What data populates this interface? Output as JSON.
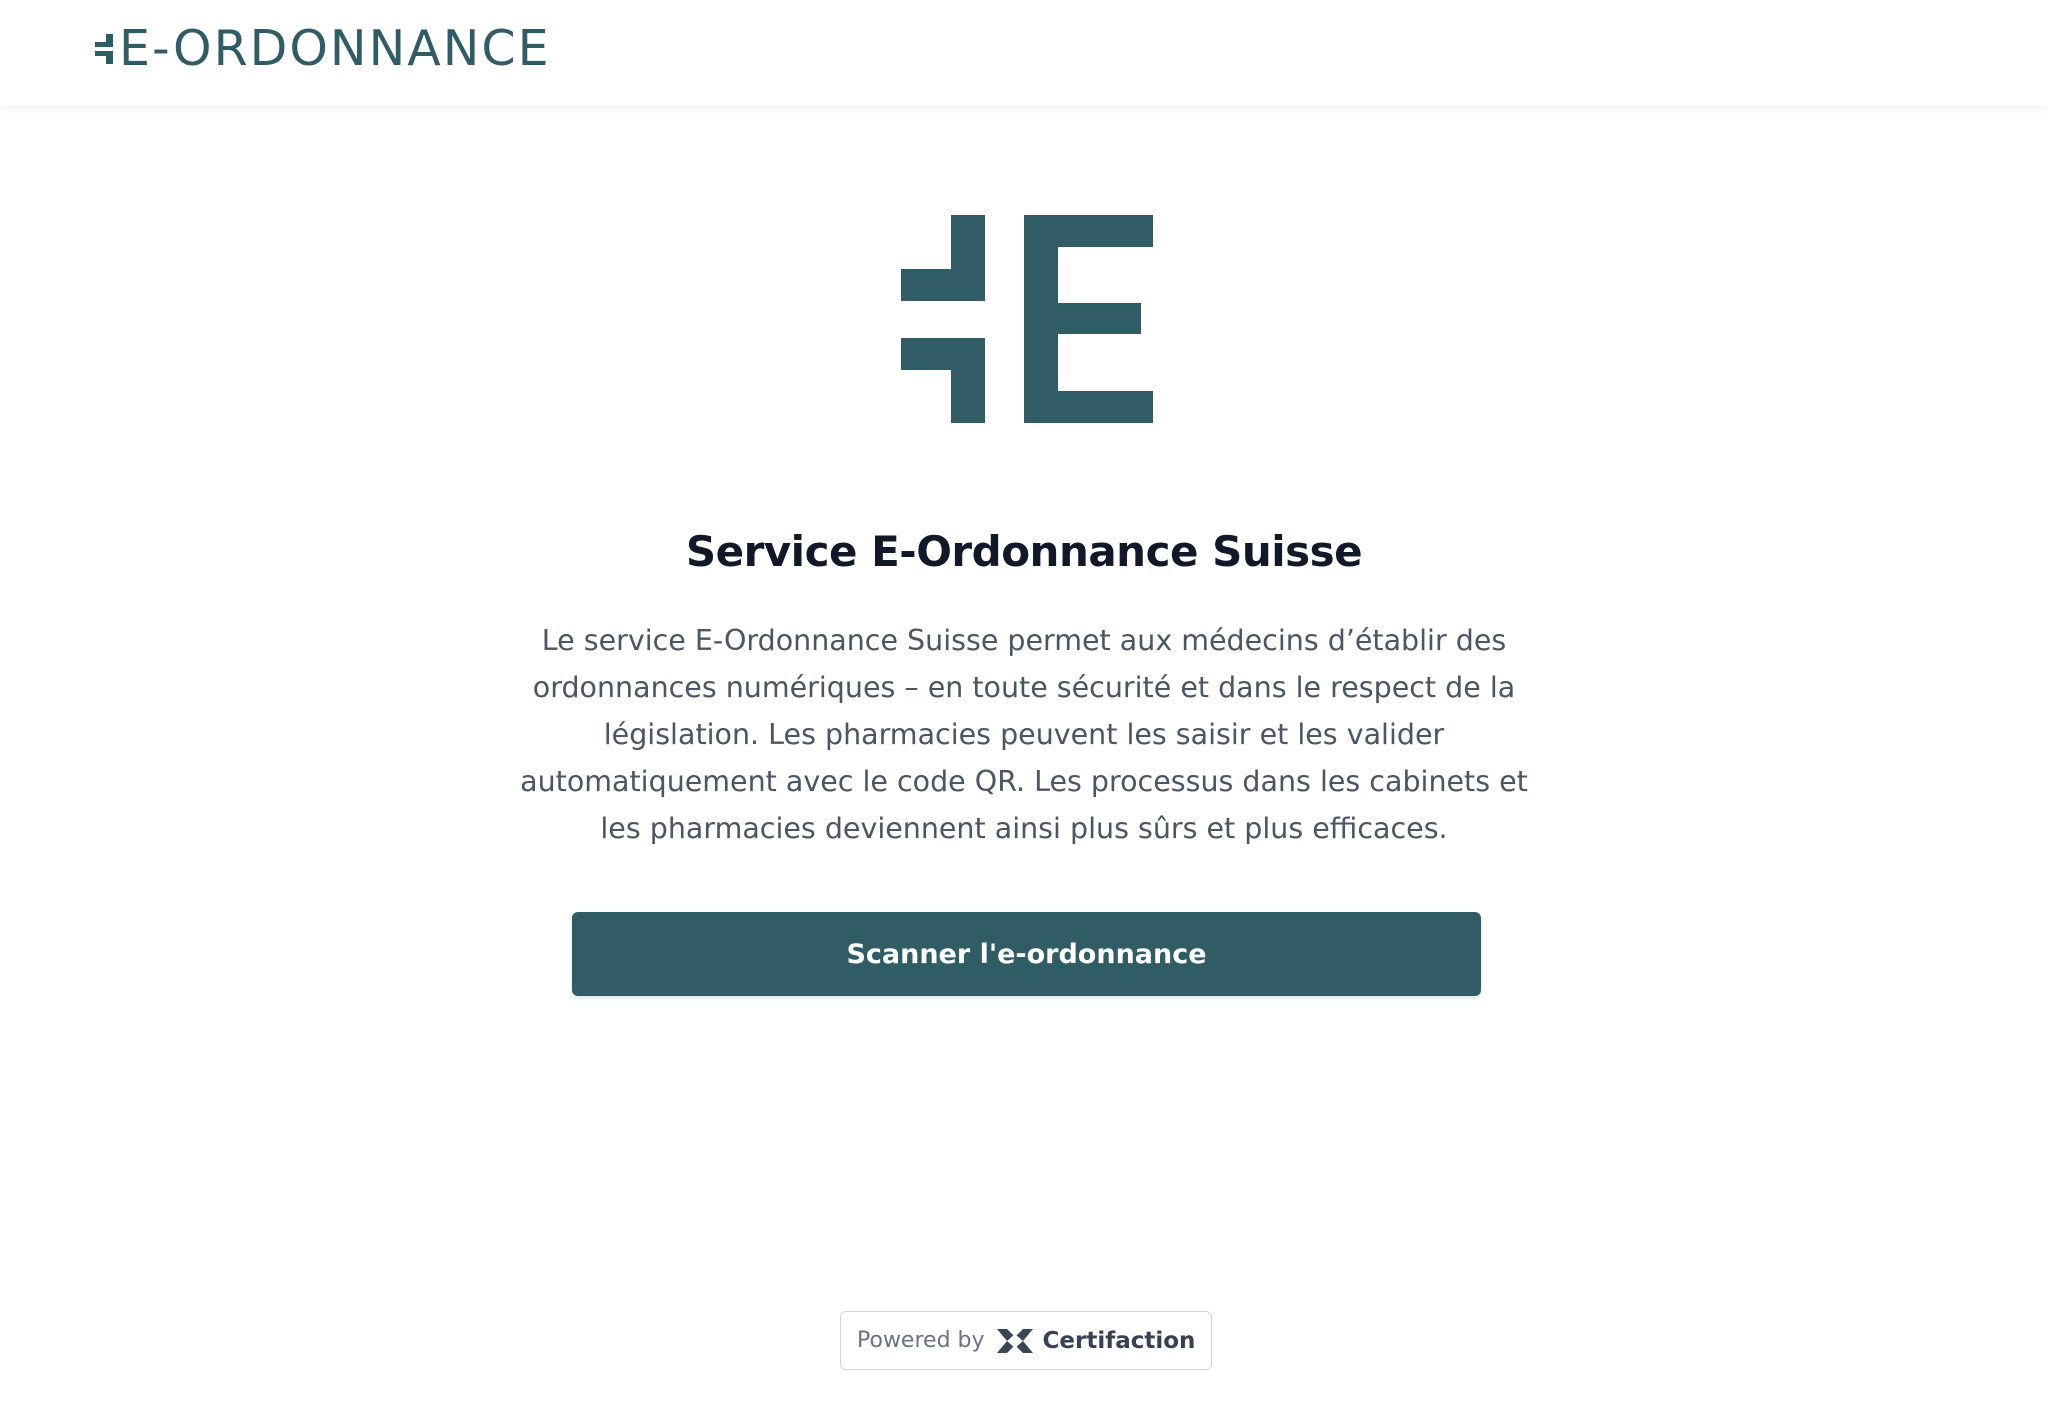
{
  "header": {
    "brand_name": "E-ORDONNANCE",
    "brand_icon": "e-ordonnance-mark-icon"
  },
  "hero": {
    "logo_icon": "e-ordonnance-logo-icon",
    "title": "Service E-Ordonnance Suisse",
    "description": "Le service E-Ordonnance Suisse permet aux médecins d’établir des ordonnances numériques – en toute sécurité et dans le respect de la législation. Les pharmacies peuvent les saisir et les valider automatiquement avec le code QR. Les processus dans les cabinets et les pharmacies deviennent ainsi plus sûrs et plus efficaces.",
    "button_label": "Scanner l'e-ordonnance"
  },
  "footer": {
    "powered_label": "Powered by",
    "provider_name": "Certifaction",
    "provider_icon": "certifaction-logo-icon"
  },
  "colors": {
    "brand": "#305c66",
    "heading": "#111827",
    "body_text": "#4b5563",
    "background": "#ffffff"
  }
}
